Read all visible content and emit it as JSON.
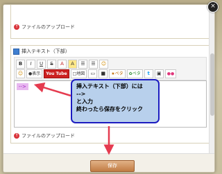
{
  "dialog": {
    "close_glyph": "×",
    "top_section": {
      "upload_label": "ファイルのアップロード"
    },
    "panel": {
      "title": "挿入テキスト（下部）",
      "toolbar_row1": [
        "B",
        "I",
        "U",
        "S",
        "A",
        "A",
        "☰",
        "☰",
        "☺"
      ],
      "toolbar_row2": [
        "☺",
        "●表示",
        "You Tube",
        "□地図",
        "▭",
        "■",
        "★ペタ",
        "✿ペタ",
        "t",
        "▣",
        "●●"
      ],
      "editor_value": "-->",
      "upload_label": "ファイルのアップロード"
    },
    "annotation": {
      "lines": [
        "挿入テキスト（下部）には",
        "-->",
        "と入力",
        "終わったら保存をクリック"
      ],
      "color_border": "#1c1cc0",
      "color_bg": "#b8d0ec",
      "arrow_color": "#e53b4f"
    },
    "footer": {
      "save_label": "保存"
    }
  }
}
